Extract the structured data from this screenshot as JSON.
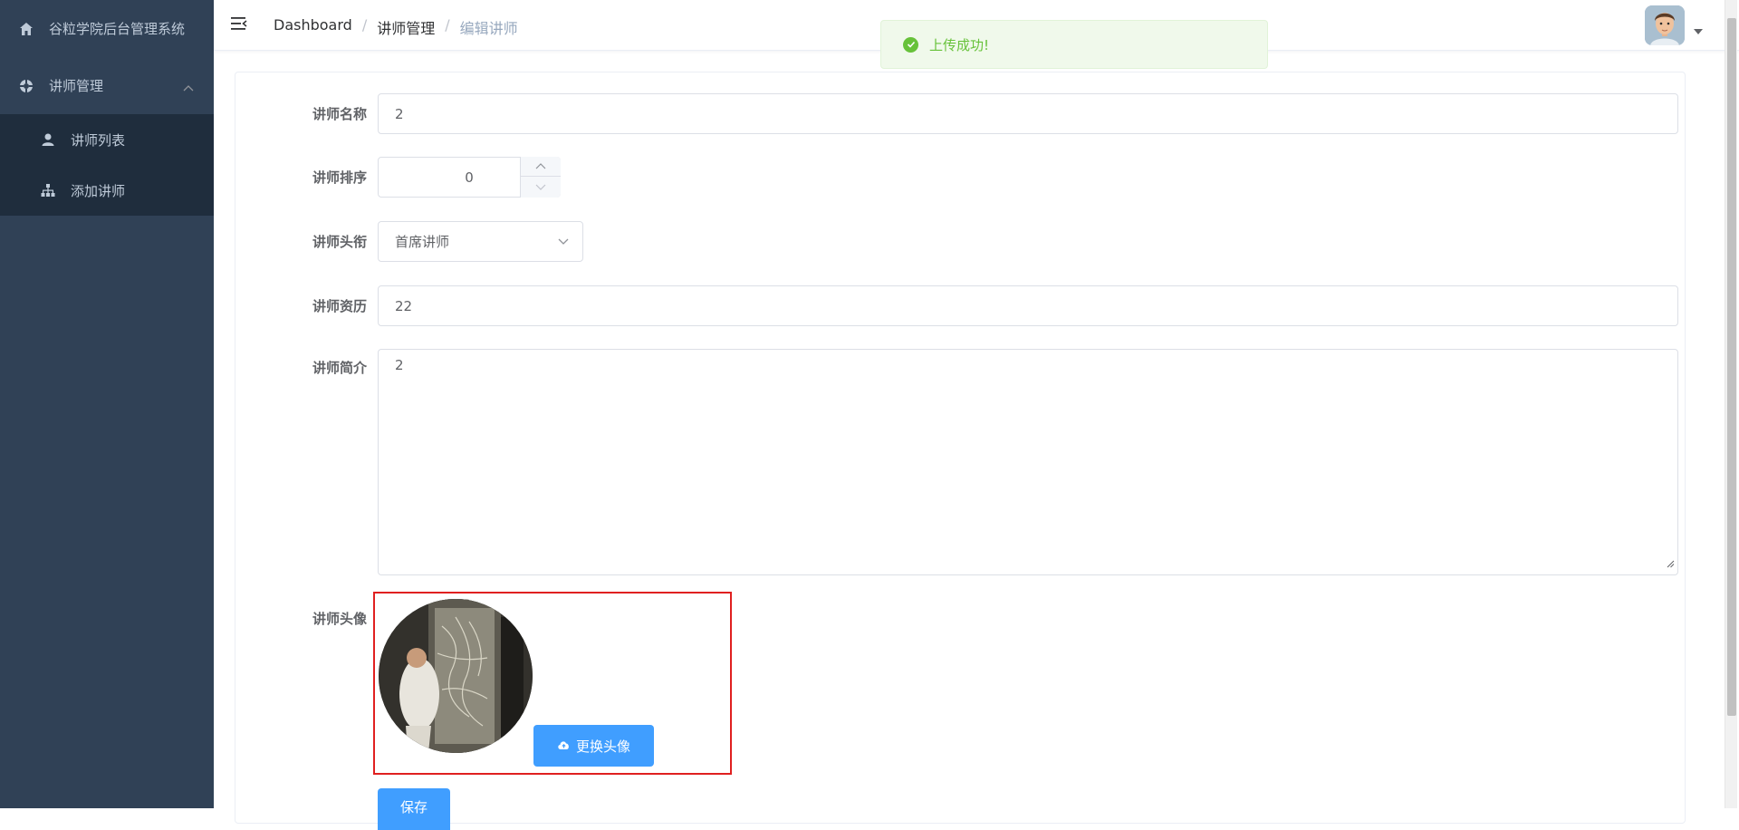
{
  "sidebar": {
    "title": "谷粒学院后台管理系统",
    "group": {
      "label": "讲师管理",
      "icon": "help-circle-icon"
    },
    "items": [
      {
        "label": "讲师列表",
        "icon": "user-icon"
      },
      {
        "label": "添加讲师",
        "icon": "tree-icon"
      }
    ]
  },
  "navbar": {
    "breadcrumb": [
      "Dashboard",
      "讲师管理",
      "编辑讲师"
    ],
    "separator": "/"
  },
  "toast": {
    "message": "上传成功!",
    "type": "success"
  },
  "form": {
    "name": {
      "label": "讲师名称",
      "value": "2"
    },
    "sort": {
      "label": "讲师排序",
      "value": "0"
    },
    "level": {
      "label": "讲师头衔",
      "value": "首席讲师"
    },
    "career": {
      "label": "讲师资历",
      "value": "22"
    },
    "intro": {
      "label": "讲师简介",
      "value": "2"
    },
    "avatar": {
      "label": "讲师头像",
      "button": "更换头像"
    },
    "save_button": "保存"
  },
  "colors": {
    "sidebar_bg": "#304156",
    "submenu_bg": "#1f2d3d",
    "primary": "#409eff",
    "success": "#67c23a",
    "highlight": "#e02020"
  }
}
